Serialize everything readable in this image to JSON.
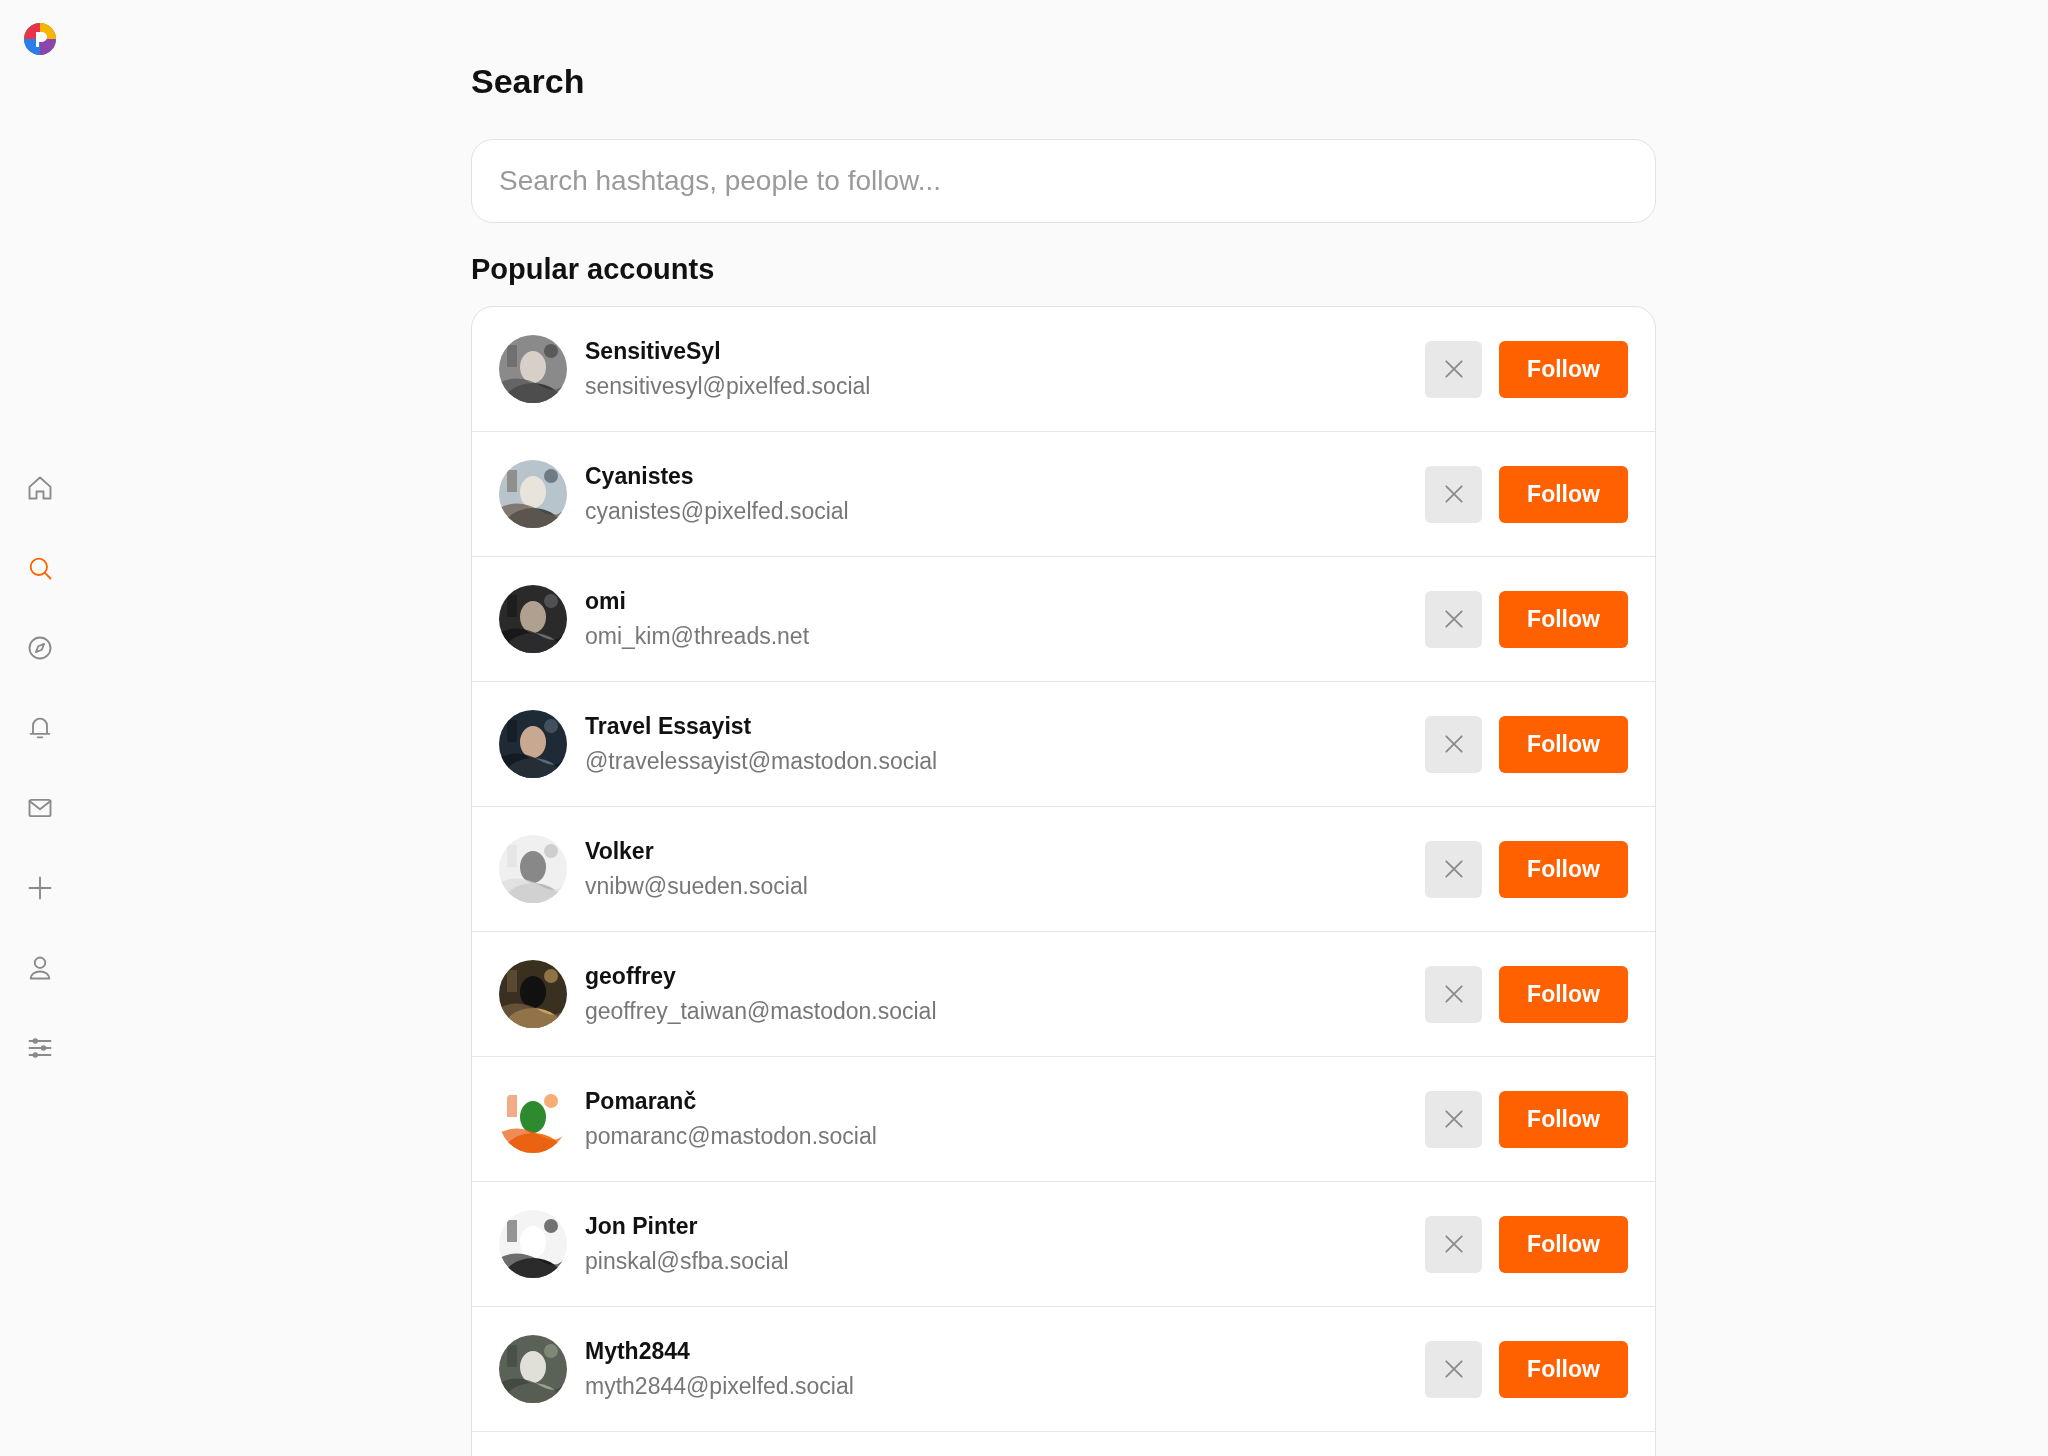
{
  "sidebar": {
    "items": [
      {
        "selected": false
      },
      {
        "selected": true
      },
      {
        "selected": false
      },
      {
        "selected": false
      },
      {
        "selected": false
      },
      {
        "selected": false
      },
      {
        "selected": false
      },
      {
        "selected": false
      }
    ]
  },
  "title": "Search",
  "search": {
    "placeholder": "Search hashtags, people to follow..."
  },
  "section_title": "Popular accounts",
  "accounts": [
    {
      "name": "SensitiveSyl",
      "handle": "sensitivesyl@pixelfed.social",
      "button": "Follow"
    },
    {
      "name": "Cyanistes",
      "handle": "cyanistes@pixelfed.social",
      "button": "Follow"
    },
    {
      "name": "omi",
      "handle": "omi_kim@threads.net",
      "button": "Follow"
    },
    {
      "name": "Travel Essayist",
      "handle": "@travelessayist@mastodon.social",
      "button": "Follow"
    },
    {
      "name": "Volker",
      "handle": "vnibw@sueden.social",
      "button": "Follow"
    },
    {
      "name": "geoffrey",
      "handle": "geoffrey_taiwan@mastodon.social",
      "button": "Follow"
    },
    {
      "name": "Pomaranč",
      "handle": "pomaranc@mastodon.social",
      "button": "Follow"
    },
    {
      "name": "Jon Pinter",
      "handle": "pinskal@sfba.social",
      "button": "Follow"
    },
    {
      "name": "Myth2844",
      "handle": "myth2844@pixelfed.social",
      "button": "Follow"
    }
  ]
}
